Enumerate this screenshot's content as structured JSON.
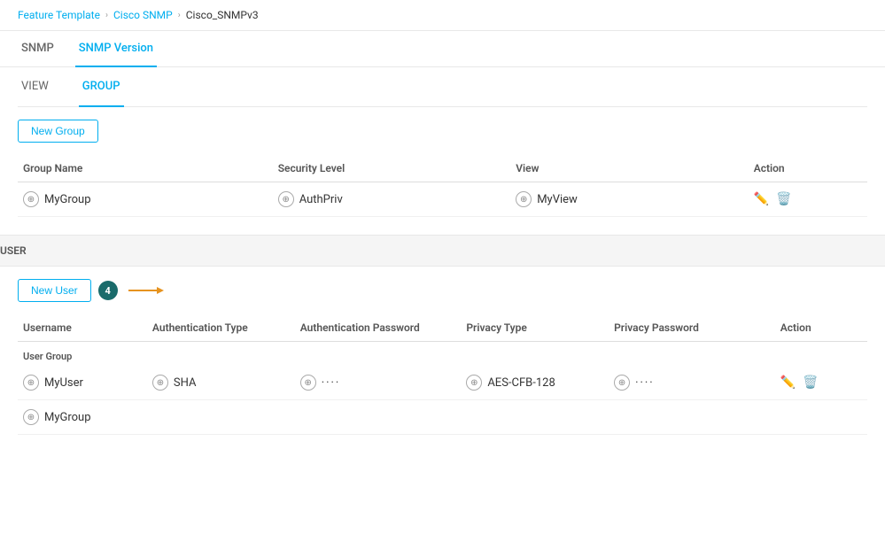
{
  "breadcrumb": {
    "items": [
      {
        "label": "Feature Template"
      },
      {
        "label": "Cisco SNMP"
      },
      {
        "label": "Cisco_SNMPv3"
      }
    ]
  },
  "tabs": {
    "items": [
      {
        "label": "SNMP",
        "active": false
      },
      {
        "label": "SNMP Version",
        "active": true
      }
    ]
  },
  "subTabs": {
    "items": [
      {
        "label": "VIEW",
        "active": false
      },
      {
        "label": "GROUP",
        "active": true
      }
    ]
  },
  "newGroupButton": "New Group",
  "groupTable": {
    "headers": [
      "Group Name",
      "Security Level",
      "View",
      "Action"
    ],
    "rows": [
      {
        "groupName": "MyGroup",
        "securityLevel": "AuthPriv",
        "view": "MyView"
      }
    ]
  },
  "userSection": {
    "label": "USER",
    "newUserButton": "New User",
    "annotationNumber": "4",
    "table": {
      "headers": [
        "Username",
        "Authentication Type",
        "Authentication Password",
        "Privacy Type",
        "Privacy Password",
        "Action"
      ],
      "subHeader": "User Group",
      "rows": [
        {
          "username": "MyUser",
          "authType": "SHA",
          "authPassword": "••••",
          "privacyType": "AES-CFB-128",
          "privacyPassword": "••••",
          "userGroup": "MyGroup"
        }
      ]
    }
  }
}
